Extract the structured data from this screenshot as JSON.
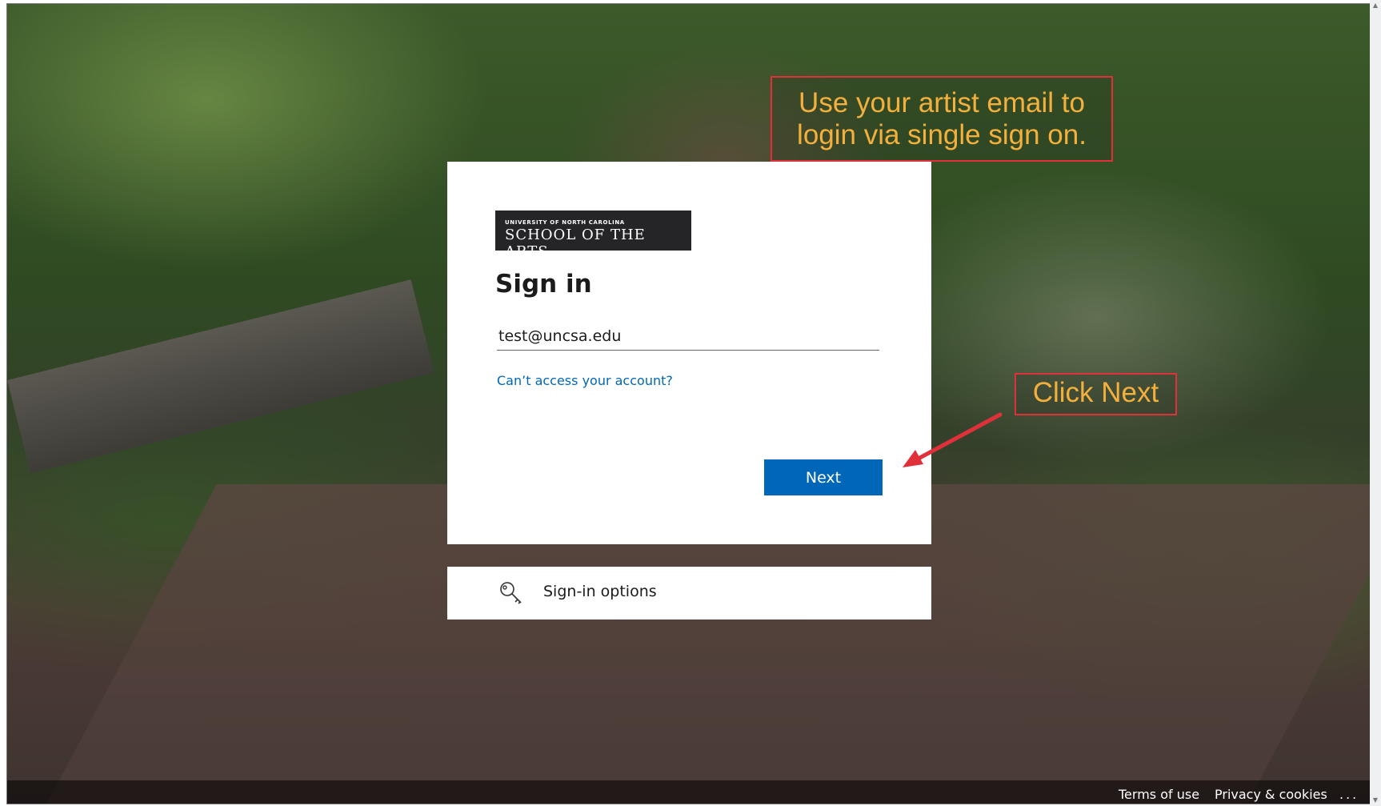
{
  "card": {
    "logo_small": "UNIVERSITY OF NORTH CAROLINA",
    "logo_big": "SCHOOL OF THE ARTS",
    "title": "Sign in",
    "email_value": "test@uncsa.edu",
    "cant_access": "Can’t access your account?",
    "next_label": "Next"
  },
  "sign_in_options": {
    "label": "Sign-in options",
    "icon": "key-search-icon"
  },
  "callouts": {
    "email_hint": "Use your artist email to login via single sign on.",
    "next_hint": "Click Next"
  },
  "footer": {
    "terms": "Terms of use",
    "privacy": "Privacy & cookies",
    "more": "..."
  },
  "colors": {
    "accent": "#0067b8",
    "callout_border": "#e0303a",
    "callout_text": "#f4b03c"
  }
}
